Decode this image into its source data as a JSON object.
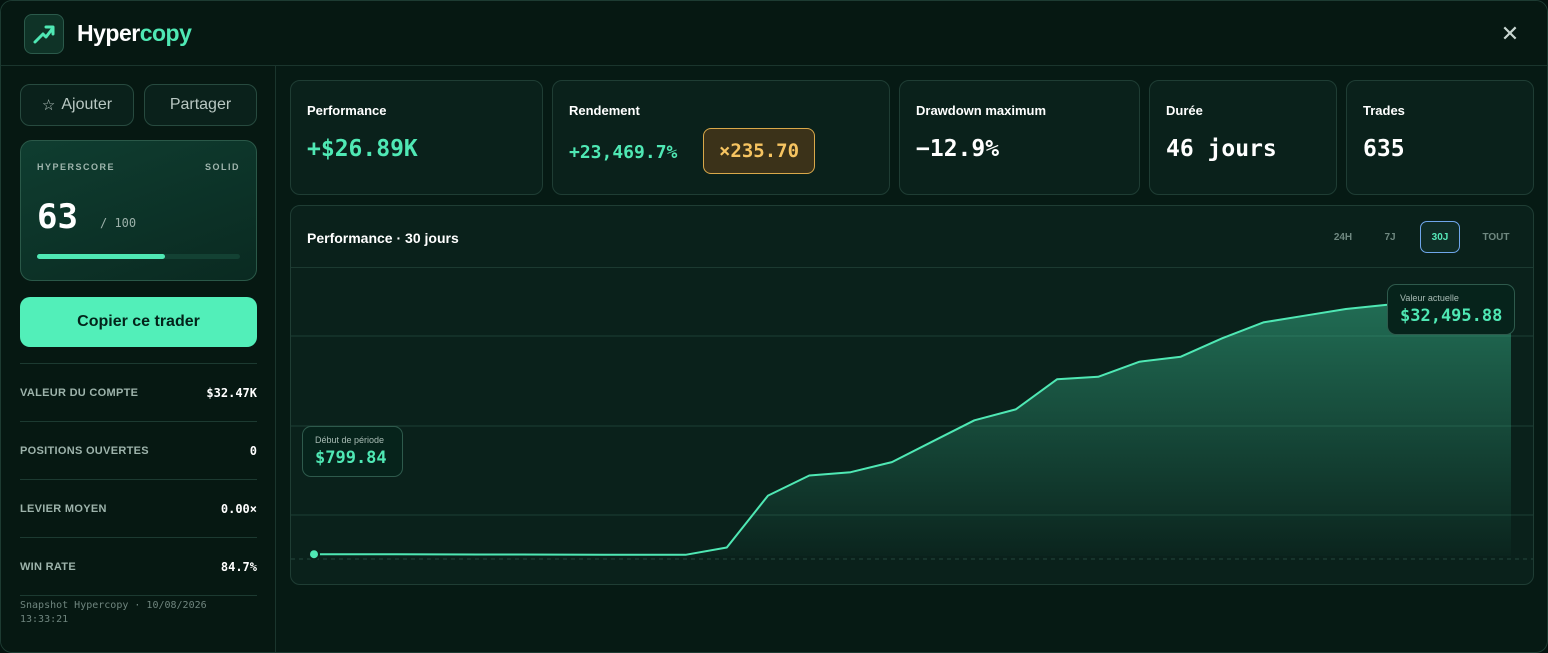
{
  "app": {
    "brand_main": "Hyper",
    "brand_accent": "copy"
  },
  "sidebar": {
    "add_label": "Ajouter",
    "share_label": "Partager",
    "hyperscore": {
      "label": "HYPERSCORE",
      "tier": "SOLID",
      "value": "63",
      "max": "/ 100",
      "fill": 0.63
    },
    "copy_label": "Copier ce trader",
    "stats": [
      {
        "label": "VALEUR DU COMPTE",
        "value": "$32.47K"
      },
      {
        "label": "POSITIONS OUVERTES",
        "value": "0"
      },
      {
        "label": "LEVIER MOYEN",
        "value": "0.00×"
      },
      {
        "label": "WIN RATE",
        "value": "84.7%"
      }
    ],
    "snapshot_line1": "Snapshot Hypercopy · 10/08/2026",
    "snapshot_line2": "13:33:21"
  },
  "metrics": {
    "performance": {
      "title": "Performance",
      "value": "+$26.89K"
    },
    "rendement": {
      "title": "Rendement",
      "value": "+23,469.7%",
      "multiplier": "×235.70"
    },
    "drawdown": {
      "title": "Drawdown maximum",
      "value": "−12.9%"
    },
    "duree": {
      "title": "Durée",
      "value": "46 jours"
    },
    "trades": {
      "title": "Trades",
      "value": "635"
    }
  },
  "chart": {
    "title": "Performance · 30 jours",
    "ranges": [
      "24H",
      "7J",
      "30J",
      "TOUT"
    ],
    "active_range": "30J",
    "start_tooltip": {
      "label": "Début de période",
      "value": "$799.84"
    },
    "end_tooltip": {
      "label": "Valeur actuelle",
      "value": "$32,495.88"
    }
  },
  "colors": {
    "accent": "#4fe8b4",
    "badge": "#f6c461",
    "background": "#061a14"
  },
  "chart_data": {
    "type": "area",
    "x": [
      1,
      2,
      3,
      4,
      5,
      6,
      7,
      8,
      9,
      10,
      11,
      12,
      13,
      14,
      15,
      16,
      17,
      18,
      19,
      20,
      21,
      22,
      23,
      24,
      25,
      26,
      27,
      28,
      29,
      30
    ],
    "values": [
      799.84,
      800,
      790,
      780,
      770,
      760,
      750,
      745,
      740,
      730,
      1600,
      7800,
      10200,
      10600,
      11800,
      14300,
      16800,
      18100,
      21700,
      22000,
      23800,
      24400,
      26600,
      28500,
      29300,
      30100,
      30600,
      31300,
      32000,
      32495.88
    ],
    "ylim": [
      -3000,
      35000
    ],
    "grid": true
  }
}
